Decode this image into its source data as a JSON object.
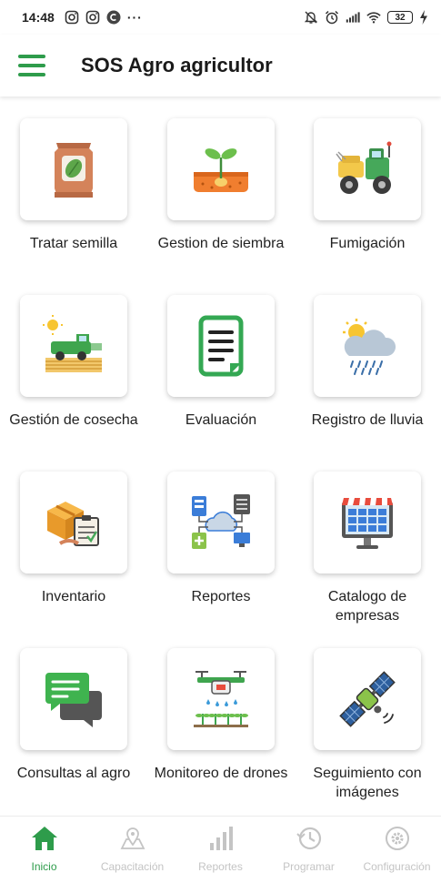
{
  "status_bar": {
    "time": "14:48",
    "more": "···",
    "battery": "32",
    "icons": [
      "instagram-icon",
      "instagram-icon",
      "copyright-app-icon",
      "mute-icon",
      "alarm-icon",
      "signal-icon",
      "wifi-icon",
      "battery-icon",
      "charging-icon"
    ]
  },
  "app_bar": {
    "title": "SOS Agro agricultor",
    "menu_icon": "hamburger-menu-icon"
  },
  "grid": {
    "tiles": [
      {
        "label": "Tratar semilla",
        "icon": "seed-bag-icon"
      },
      {
        "label": "Gestion de siembra",
        "icon": "sprout-soil-icon"
      },
      {
        "label": "Fumigación",
        "icon": "tractor-sprayer-icon"
      },
      {
        "label": "Gestión de cosecha",
        "icon": "harvester-icon"
      },
      {
        "label": "Evaluación",
        "icon": "document-list-icon"
      },
      {
        "label": "Registro de lluvia",
        "icon": "rain-cloud-icon"
      },
      {
        "label": "Inventario",
        "icon": "boxes-clipboard-icon"
      },
      {
        "label": "Reportes",
        "icon": "network-reports-icon"
      },
      {
        "label": "Catalogo de empresas",
        "icon": "storefront-monitor-icon"
      },
      {
        "label": "Consultas al agro",
        "icon": "chat-bubbles-icon"
      },
      {
        "label": "Monitoreo de drones",
        "icon": "drone-irrigation-icon"
      },
      {
        "label": "Seguimiento con imágenes",
        "icon": "satellite-icon"
      }
    ]
  },
  "bottom_nav": {
    "items": [
      {
        "label": "Inicio",
        "icon": "home-icon",
        "active": true
      },
      {
        "label": "Capacitación",
        "icon": "map-pin-icon",
        "active": false
      },
      {
        "label": "Reportes",
        "icon": "bar-chart-icon",
        "active": false
      },
      {
        "label": "Programar",
        "icon": "schedule-clock-icon",
        "active": false
      },
      {
        "label": "Configuración",
        "icon": "settings-gear-icon",
        "active": false
      }
    ]
  },
  "colors": {
    "accent": "#2e9c4b",
    "inactive": "#c4c4c4"
  }
}
